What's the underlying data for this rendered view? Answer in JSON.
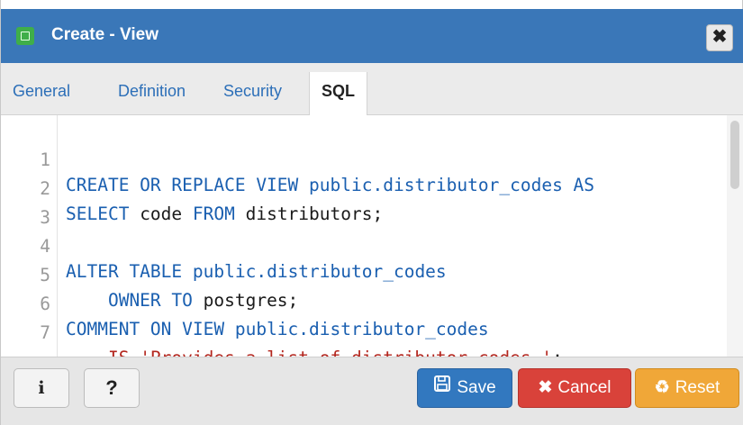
{
  "dialog": {
    "title": "Create - View",
    "close_label": "✖"
  },
  "tabs": [
    {
      "label": "General"
    },
    {
      "label": "Definition"
    },
    {
      "label": "Security"
    },
    {
      "label": "SQL",
      "active": true
    }
  ],
  "editor": {
    "lines": [
      {
        "number": "1"
      },
      {
        "number": "2"
      },
      {
        "number": "3"
      },
      {
        "number": "4"
      },
      {
        "number": "5"
      },
      {
        "number": "6"
      },
      {
        "number": "7"
      }
    ],
    "tokens": {
      "l1": [
        "CREATE OR REPLACE VIEW ",
        "public",
        ".distributor_codes ",
        "AS"
      ],
      "l2": [
        "SELECT ",
        "code ",
        "FROM ",
        "distributors;"
      ],
      "l4": [
        "ALTER TABLE ",
        "public",
        ".distributor_codes"
      ],
      "l5": [
        "    OWNER TO ",
        "postgres;"
      ],
      "l6": [
        "COMMENT ON VIEW ",
        "public",
        ".distributor_codes"
      ],
      "l7": [
        "    IS ",
        "'Provides a list of distributor codes.'",
        ";"
      ]
    }
  },
  "footer": {
    "info_label": "i",
    "help_label": "?",
    "save_label": "Save",
    "cancel_label": "Cancel",
    "reset_label": "Reset"
  },
  "colors": {
    "titlebar": "#3a77b8",
    "keyword": "#1a5fb0",
    "string": "#b3261e",
    "save": "#3278bf",
    "cancel": "#d9423a",
    "reset": "#f0a738"
  },
  "icons": {
    "title": "view-icon",
    "save": "floppy-disk-icon",
    "cancel": "x-icon",
    "reset": "recycle-icon"
  }
}
